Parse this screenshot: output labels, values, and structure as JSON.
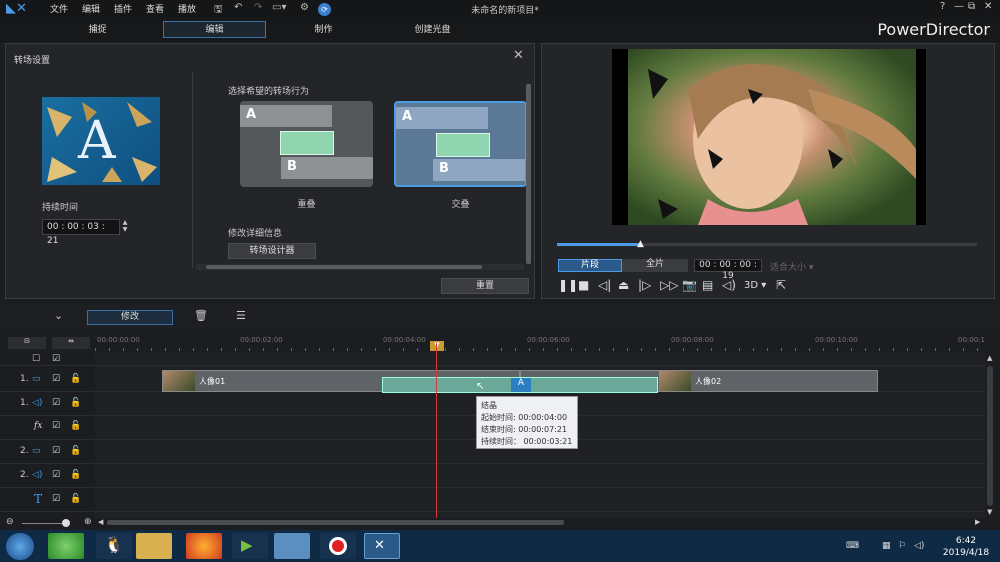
{
  "menu": [
    "文件",
    "编辑",
    "插件",
    "查看",
    "播放"
  ],
  "doc_title": "未命名的新项目*",
  "window_buttons": {
    "help": "?",
    "minimize": "—",
    "restore": "⧉",
    "close": "✕"
  },
  "modes": [
    "捕捉",
    "编辑",
    "制作",
    "创建光盘"
  ],
  "active_mode": "编辑",
  "brand": "PowerDirector",
  "transition_panel": {
    "title": "转场设置",
    "duration_label": "持续时间",
    "duration_value": "00 : 00 : 03 : 21",
    "choose_label": "选择希望的转场行为",
    "option_overlap": "重叠",
    "option_cross": "交叠",
    "block_a": "A",
    "block_b": "B",
    "modify_label": "修改详细信息",
    "designer_button": "转场设计器",
    "reset_button": "重置",
    "thumb_letter": "A"
  },
  "preview": {
    "clip_tab": "片段",
    "movie_tab": "全片",
    "timecode": "00 : 00 : 00 : 19",
    "fit_label": "适合大小",
    "mode_3d": "3D",
    "progress": 0.2
  },
  "timeline": {
    "modify_button": "修改",
    "ruler_ticks": [
      "00:00:00:00",
      "00:00:02:00",
      "00:00:04:00",
      "00:00:06:00",
      "00:00:08:00",
      "00:00:10:00",
      "00:00:1"
    ],
    "tracks": [
      {
        "num": "1.",
        "type": "video"
      },
      {
        "num": "1.",
        "type": "audio"
      },
      {
        "num": "",
        "type": "fx",
        "label": "fx"
      },
      {
        "num": "2.",
        "type": "video"
      },
      {
        "num": "2.",
        "type": "audio"
      },
      {
        "num": "",
        "type": "title",
        "label": "T"
      }
    ],
    "clip1_label": "人像01",
    "clip2_label": "人像02",
    "tooltip": {
      "title": "结晶",
      "start": "起始时间: 00:00:04:00",
      "end": "结束时间: 00:00:07:21",
      "duration": "持续时间：  00:00:03:21"
    }
  },
  "taskbar": {
    "time": "6:42",
    "date": "2019/4/18"
  }
}
